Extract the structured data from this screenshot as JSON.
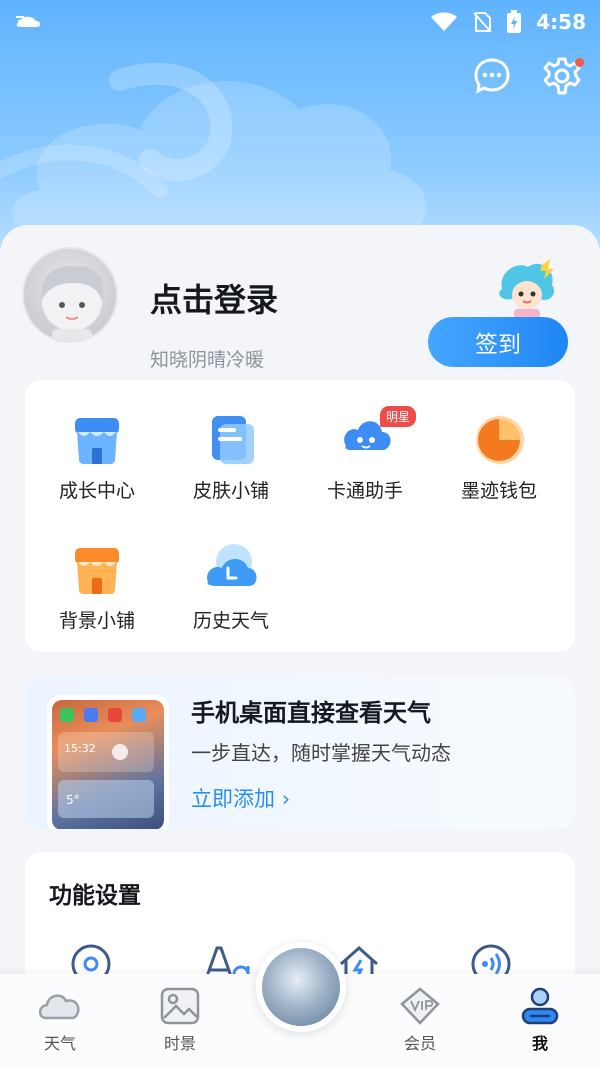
{
  "status_bar": {
    "time": "4:58"
  },
  "profile": {
    "title": "点击登录",
    "subtitle": "知晓阴晴冷暖",
    "signin_label": "签到"
  },
  "services": [
    {
      "label": "成长中心",
      "icon": "shop-blue-icon"
    },
    {
      "label": "皮肤小铺",
      "icon": "document-icon"
    },
    {
      "label": "卡通助手",
      "icon": "cartoon-cloud-icon",
      "badge": "明星"
    },
    {
      "label": "墨迹钱包",
      "icon": "wallet-pie-icon"
    },
    {
      "label": "背景小铺",
      "icon": "shop-orange-icon"
    },
    {
      "label": "历史天气",
      "icon": "history-weather-icon"
    }
  ],
  "promo": {
    "title": "手机桌面直接查看天气",
    "subtitle": "一步直达，随时掌握天气动态",
    "link": "立即添加",
    "widget_time": "15:32",
    "widget_temp": "5°"
  },
  "settings": {
    "title": "功能设置"
  },
  "tabbar": {
    "items": [
      {
        "label": "天气",
        "icon": "cloud-icon"
      },
      {
        "label": "时景",
        "icon": "image-icon"
      },
      {
        "label": "会员",
        "icon": "vip-icon"
      },
      {
        "label": "我",
        "icon": "person-icon"
      }
    ]
  },
  "colors": {
    "accent": "#2b8cf5",
    "badge": "#ef4b4b"
  }
}
